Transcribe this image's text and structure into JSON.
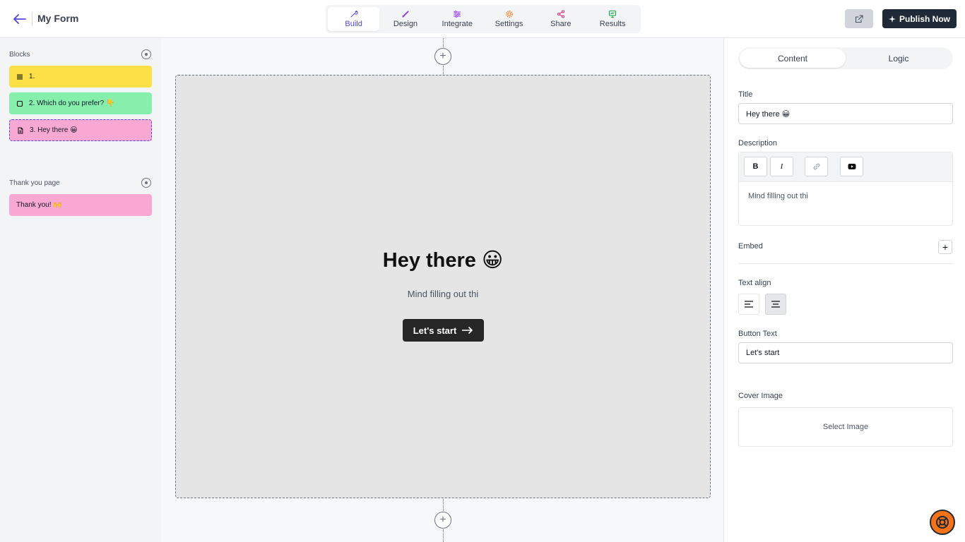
{
  "header": {
    "title": "My Form",
    "tabs": [
      {
        "label": "Build",
        "icon": "wrench-icon",
        "color": "#4f46e5"
      },
      {
        "label": "Design",
        "icon": "brush-icon",
        "color": "#7c3aed"
      },
      {
        "label": "Integrate",
        "icon": "sliders-icon",
        "color": "#9333ea"
      },
      {
        "label": "Settings",
        "icon": "gear-icon",
        "color": "#f97316"
      },
      {
        "label": "Share",
        "icon": "share-icon",
        "color": "#db2777"
      },
      {
        "label": "Results",
        "icon": "monitor-icon",
        "color": "#16a34a"
      }
    ],
    "active_tab": "Build",
    "publish_label": "Publish Now"
  },
  "sidebar": {
    "blocks_label": "Blocks",
    "blocks": [
      {
        "label": "1.",
        "color": "#fde047",
        "icon": "list-icon"
      },
      {
        "label": "2. Which do you prefer? 👇",
        "color": "#86efac",
        "icon": "square-icon"
      },
      {
        "label": "3. Hey there 😀",
        "color": "#f9a8d4",
        "icon": "document-icon",
        "selected": true
      }
    ],
    "thankyou_label": "Thank you page",
    "thankyou_blocks": [
      {
        "label": "Thank you! 🙌",
        "color": "#f9a8d4"
      }
    ]
  },
  "canvas": {
    "title": "Hey there 😀",
    "description": "Mind filling out thi",
    "button_label": "Let's start"
  },
  "panel": {
    "tabs": [
      "Content",
      "Logic"
    ],
    "active_tab": "Content",
    "title_label": "Title",
    "title_value": "Hey there 😀",
    "description_label": "Description",
    "description_value": "Mind filling out thi",
    "toolbar": {
      "bold": "B",
      "italic": "I"
    },
    "embed_label": "Embed",
    "text_align_label": "Text align",
    "button_text_label": "Button Text",
    "button_text_value": "Let's start",
    "cover_image_label": "Cover Image",
    "select_image_label": "Select Image"
  }
}
